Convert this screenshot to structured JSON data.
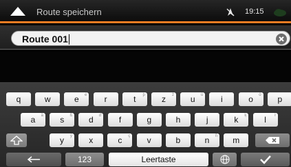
{
  "header": {
    "title": "Route speichern",
    "time": "19:15"
  },
  "input": {
    "value": "Route 001"
  },
  "keyboard": {
    "row1": [
      {
        "label": "q",
        "alt": ""
      },
      {
        "label": "w",
        "alt": ""
      },
      {
        "label": "e",
        "alt": "é"
      },
      {
        "label": "r",
        "alt": ""
      },
      {
        "label": "t",
        "alt": "þ"
      },
      {
        "label": "z",
        "alt": "ž"
      },
      {
        "label": "u",
        "alt": "ü"
      },
      {
        "label": "i",
        "alt": ""
      },
      {
        "label": "o",
        "alt": "ö"
      },
      {
        "label": "p",
        "alt": ""
      }
    ],
    "row2": [
      {
        "label": "a",
        "alt": "ä"
      },
      {
        "label": "s",
        "alt": "ß"
      },
      {
        "label": "d",
        "alt": "ď"
      },
      {
        "label": "f",
        "alt": ""
      },
      {
        "label": "g",
        "alt": ""
      },
      {
        "label": "h",
        "alt": ""
      },
      {
        "label": "j",
        "alt": ""
      },
      {
        "label": "k",
        "alt": "ķ"
      },
      {
        "label": "l",
        "alt": "ł"
      }
    ],
    "row3": [
      {
        "label": "y",
        "alt": "ý"
      },
      {
        "label": "x",
        "alt": ""
      },
      {
        "label": "c",
        "alt": "ç"
      },
      {
        "label": "v",
        "alt": ""
      },
      {
        "label": "b",
        "alt": ""
      },
      {
        "label": "n",
        "alt": "ñ"
      },
      {
        "label": "m",
        "alt": ""
      }
    ],
    "numbers_label": "123",
    "space_label": "Leertaste"
  },
  "icons": {
    "back": "up-arrow-icon",
    "gps": "gps-off-icon",
    "clear": "clear-icon",
    "shift": "shift-arrow-icon",
    "backspace": "backspace-icon",
    "left": "left-arrow-icon",
    "language": "globe-icon",
    "confirm": "checkmark-icon"
  },
  "colors": {
    "accent": "#f07c22",
    "key_light": "#ffffff",
    "key_dark": "#5a5a5a"
  }
}
